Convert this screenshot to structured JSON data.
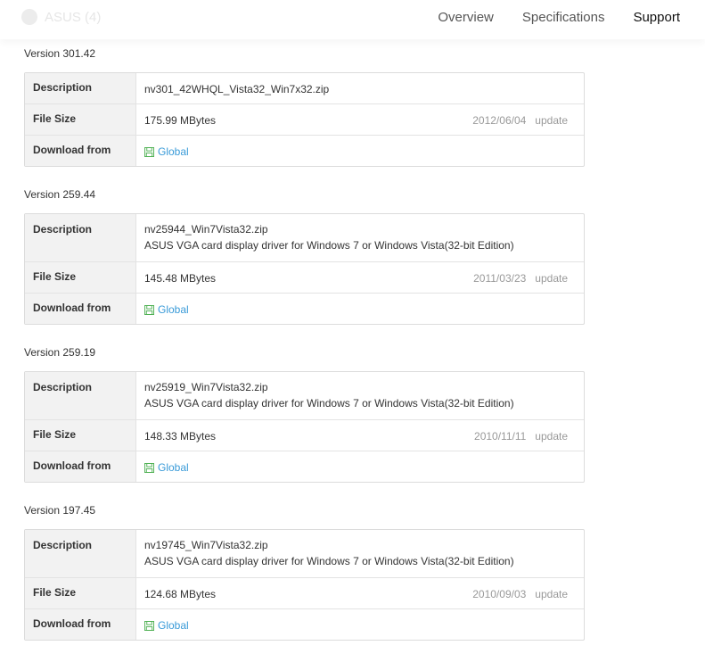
{
  "header": {
    "ghost_title": "ASUS (4)",
    "tabs": [
      {
        "label": "Overview"
      },
      {
        "label": "Specifications"
      },
      {
        "label": "Support"
      }
    ]
  },
  "labels": {
    "description": "Description",
    "file_size": "File Size",
    "download_from": "Download from",
    "global": "Global",
    "update": "update"
  },
  "versions": [
    {
      "label": "Version 301.42",
      "file": "nv301_42WHQL_Vista32_Win7x32.zip",
      "desc": "",
      "size": "175.99 MBytes",
      "date": "2012/06/04"
    },
    {
      "label": "Version 259.44",
      "file": "nv25944_Win7Vista32.zip",
      "desc": "ASUS VGA card display driver for Windows 7 or Windows Vista(32-bit Edition)",
      "size": "145.48 MBytes",
      "date": "2011/03/23"
    },
    {
      "label": "Version 259.19",
      "file": "nv25919_Win7Vista32.zip",
      "desc": "ASUS VGA card display driver for Windows 7 or Windows Vista(32-bit Edition)",
      "size": "148.33 MBytes",
      "date": "2010/11/11"
    },
    {
      "label": "Version 197.45",
      "file": "nv19745_Win7Vista32.zip",
      "desc": "ASUS VGA card display driver for Windows 7 or Windows Vista(32-bit Edition)",
      "size": "124.68 MBytes",
      "date": "2010/09/03"
    }
  ],
  "colors": {
    "link": "#3a9bd8",
    "icon": "#4caf50",
    "muted": "#999999"
  }
}
